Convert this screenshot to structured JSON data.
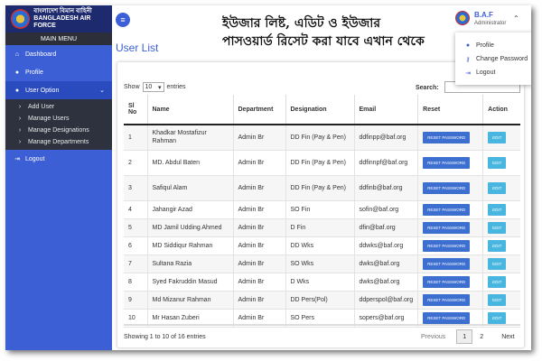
{
  "logo": {
    "line1": "বাংলাদেশ বিমান বাহিনী",
    "line2": "BANGLADESH AIR FORCE"
  },
  "sidebar": {
    "main_menu": "MAIN MENU",
    "items": [
      {
        "label": "Dashboard",
        "icon": "home-icon"
      },
      {
        "label": "Profile",
        "icon": "user-icon"
      },
      {
        "label": "User Option",
        "icon": "users-icon"
      }
    ],
    "sub_items": [
      {
        "label": "Add User"
      },
      {
        "label": "Manage Users"
      },
      {
        "label": "Manage Designations"
      },
      {
        "label": "Manage Departments"
      }
    ],
    "logout": "Logout"
  },
  "header": {
    "bn_line1": "ইউজার লিষ্ট, এডিট ও ইউজার",
    "bn_line2": "পাসওয়ার্ড রিসেট করা যাবে এখান থেকে",
    "page_title": "User List"
  },
  "user": {
    "name": "B.A.F",
    "role": "Administrator"
  },
  "dropdown": {
    "items": [
      {
        "label": "Profile"
      },
      {
        "label": "Change Password"
      },
      {
        "label": "Logout"
      }
    ]
  },
  "table_controls": {
    "show": "Show",
    "entries_value": "10",
    "entries": "entries",
    "search_label": "Search:",
    "search_value": ""
  },
  "table": {
    "headers": [
      "Sl No",
      "Name",
      "Department",
      "Designation",
      "Email",
      "Reset",
      "Action"
    ],
    "reset_label": "RESET PASSWORD",
    "edit_label": "EDIT",
    "rows": [
      {
        "sl": "1",
        "name": "Khadkar Mostafizur Rahman",
        "dept": "Admin Br",
        "desig": "DD Fin (Pay & Pen)",
        "email": "ddfinpp@baf.org"
      },
      {
        "sl": "2",
        "name": "MD. Abdul Baten",
        "dept": "Admin Br",
        "desig": "DD Fin (Pay & Pen)",
        "email": "ddfinnpf@baf.org"
      },
      {
        "sl": "3",
        "name": "Safiqul Alam",
        "dept": "Admin Br",
        "desig": "DD Fin (Pay & Pen)",
        "email": "ddfinb@baf.org"
      },
      {
        "sl": "4",
        "name": "Jahangir Azad",
        "dept": "Admin Br",
        "desig": "SO Fin",
        "email": "sofin@baf.org"
      },
      {
        "sl": "5",
        "name": "MD Jamil Udding Ahmed",
        "dept": "Admin Br",
        "desig": "D Fin",
        "email": "dfin@baf.org"
      },
      {
        "sl": "6",
        "name": "MD Siddiqur Rahman",
        "dept": "Admin Br",
        "desig": "DD Wks",
        "email": "ddwks@baf.org"
      },
      {
        "sl": "7",
        "name": "Sultana Razia",
        "dept": "Admin Br",
        "desig": "SO Wks",
        "email": "dwks@baf.org"
      },
      {
        "sl": "8",
        "name": "Syed Fakruddin Masud",
        "dept": "Admin Br",
        "desig": "D Wks",
        "email": "dwks@baf.org"
      },
      {
        "sl": "9",
        "name": "Md Mizanur Rahman",
        "dept": "Admin Br",
        "desig": "DD Pers(Pol)",
        "email": "ddperspol@baf.org"
      },
      {
        "sl": "10",
        "name": "Mr Hasan Zuberi",
        "dept": "Admin Br",
        "desig": "SO Pers",
        "email": "sopers@baf.org"
      }
    ]
  },
  "footer": {
    "info": "Showing 1 to 10 of 16 entries",
    "previous": "Previous",
    "page1": "1",
    "page2": "2",
    "next": "Next"
  },
  "colors": {
    "accent": "#3d5fd6",
    "logo_bg": "#1d2a6e",
    "submenu_bg": "#2d323e",
    "reset_btn": "#3d6fd1",
    "edit_btn": "#48b6df"
  }
}
